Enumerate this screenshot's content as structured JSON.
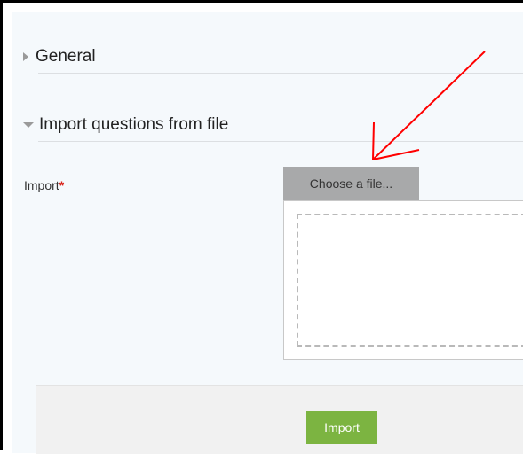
{
  "sections": {
    "general": {
      "title": "General",
      "state": "collapsed"
    },
    "import_file": {
      "title": "Import questions from file",
      "state": "expanded"
    }
  },
  "form": {
    "import_label": "Import",
    "required_marker": "*",
    "choose_file_label": "Choose a file..."
  },
  "footer": {
    "import_button_label": "Import"
  },
  "colors": {
    "accent_green": "#7cb441",
    "required_red": "#d9241b",
    "annotation_red": "#ff0000"
  }
}
